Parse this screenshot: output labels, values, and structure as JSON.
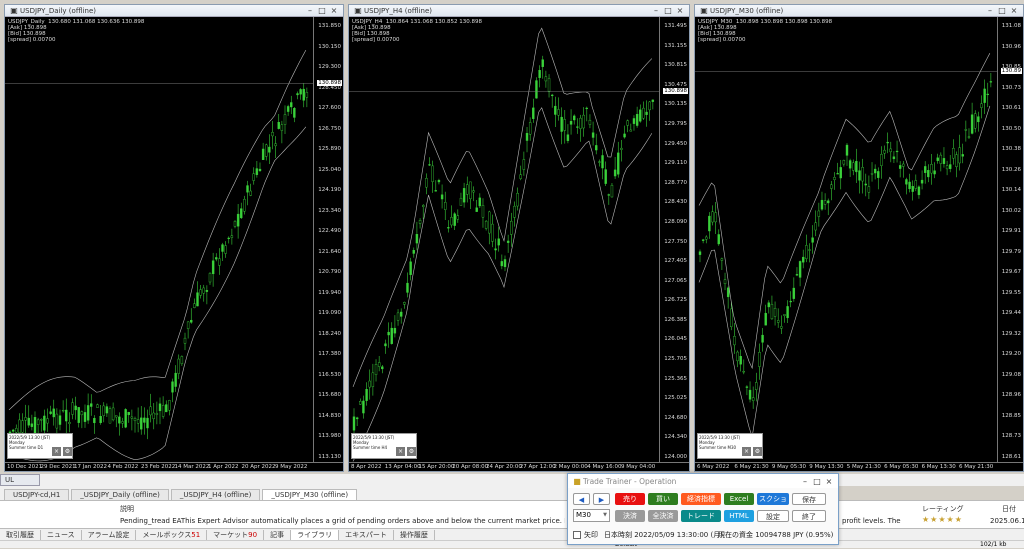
{
  "charts": [
    {
      "title": "USDJPY_Daily (offline)",
      "info": "USDJPY_Daily  130.680 131.068 130.636 130.898\n[Ask] 130.898\n[Bid] 130.898\n[spread] 0.00700",
      "prices": [
        "131.850",
        "130.150",
        "129.300",
        "128.450",
        "127.600",
        "126.750",
        "125.890",
        "125.040",
        "124.190",
        "123.340",
        "122.490",
        "121.640",
        "120.790",
        "119.940",
        "119.090",
        "118.240",
        "117.380",
        "116.530",
        "115.680",
        "114.830",
        "113.980",
        "113.130"
      ],
      "tag": "130.898",
      "times": [
        "10 Dec 2021",
        "29 Dec 2021",
        "17 Jan 2022",
        "4 Feb 2022",
        "23 Feb 2022",
        "14 Mar 2022",
        "1 Apr 2022",
        "20 Apr 2022",
        "9 May 2022"
      ],
      "mini": {
        "date": "2022/5/9 13:30 (JST)",
        "day": "Monday",
        "tf": "Summer time   D1"
      }
    },
    {
      "title": "USDJPY_H4 (offline)",
      "info": "USDJPY_H4  130.864 131.068 130.852 130.898\n[Ask] 130.898\n[Bid] 130.898\n[spread] 0.00700",
      "prices": [
        "131.495",
        "131.155",
        "130.815",
        "130.475",
        "130.135",
        "129.795",
        "129.450",
        "129.110",
        "128.770",
        "128.430",
        "128.090",
        "127.750",
        "127.405",
        "127.065",
        "126.725",
        "126.385",
        "126.045",
        "125.705",
        "125.365",
        "125.025",
        "124.680",
        "124.340",
        "124.000"
      ],
      "tag": "130.898",
      "times": [
        "8 Apr 2022",
        "13 Apr 04:00",
        "15 Apr 20:00",
        "20 Apr 08:00",
        "24 Apr 20:00",
        "27 Apr 12:00",
        "2 May 00:00",
        "4 May 16:00",
        "9 May 04:00"
      ],
      "mini": {
        "date": "2022/5/9 13:30 (JST)",
        "day": "Monday",
        "tf": "Summer time   H4"
      }
    },
    {
      "title": "USDJPY_M30 (offline)",
      "info": "USDJPY_M30  130.898 130.898 130.898 130.898\n[Ask] 130.898\n[Bid] 130.898\n[spread] 0.00700",
      "prices": [
        "131.08",
        "130.96",
        "130.85",
        "130.73",
        "130.61",
        "130.50",
        "130.38",
        "130.26",
        "130.14",
        "130.02",
        "129.91",
        "129.79",
        "129.67",
        "129.55",
        "129.44",
        "129.32",
        "129.20",
        "129.08",
        "128.96",
        "128.85",
        "128.73",
        "128.61"
      ],
      "tag": "130.89",
      "times": [
        "6 May 2022",
        "6 May 21:30",
        "9 May 05:30",
        "9 May 13:30",
        "5 May 21:30",
        "6 May 05:30",
        "6 May 13:30",
        "6 May 21:30"
      ],
      "mini": {
        "date": "2022/5/9 13:30 (JST)",
        "day": "Monday",
        "tf": "Summer time   M30"
      }
    }
  ],
  "ul_label": "UL",
  "window_tabs": [
    "USDJPY-cd,H1",
    "_USDJPY_Daily (offline)",
    "_USDJPY_H4 (offline)",
    "_USDJPY_M30 (offline)"
  ],
  "lower": {
    "header": "説明",
    "text": "Pending_tread EAThis Expert Advisor automatically places a grid of pending orders above and below the current market price. It supports both",
    "tail": "profit levels. The",
    "rating_label": "レーティング",
    "date_label": "日付",
    "date": "2025.06.10"
  },
  "bottom_tabs": [
    {
      "label": "取引履歴"
    },
    {
      "label": "ニュース"
    },
    {
      "label": "アラーム設定"
    },
    {
      "label": "メールボックス",
      "n": "51"
    },
    {
      "label": "マーケット",
      "n": "90"
    },
    {
      "label": "記事"
    },
    {
      "label": "ライブラリ"
    },
    {
      "label": "エキスパート"
    },
    {
      "label": "操作履歴"
    }
  ],
  "status": {
    "default": "Default",
    "net": "102/1 kb"
  },
  "trainer": {
    "title": "Trade Trainer - Operation",
    "sell": "売り",
    "buy": "買い",
    "indicator": "経済指標",
    "excel": "Excel",
    "screenshot": "スクショ",
    "save": "保存",
    "timeframe": "M30",
    "settle": "決済",
    "settle_all": "全決済",
    "trade": "トレード",
    "html": "HTML",
    "settings": "設定",
    "end": "終了",
    "arrow_label": "矢印",
    "time_label": "日本時刻 2022/05/09 13:30:00 (月)",
    "balance": "現在の資金 10094788 JPY (0.95%)"
  },
  "colors": {
    "sell": "#e81010",
    "buy": "#2e7d1f",
    "indicator": "#ff5a1f",
    "excel": "#2e7d1f",
    "screenshot": "#1e78d8",
    "trade": "#0a8a8a",
    "html": "#1ea0e0",
    "gray": "#9a9a9a"
  }
}
